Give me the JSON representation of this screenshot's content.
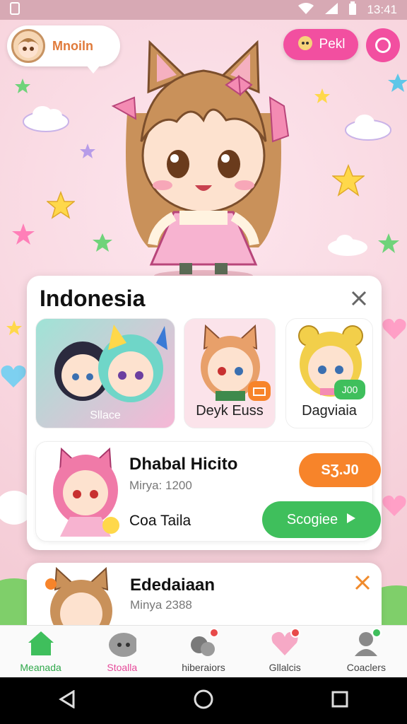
{
  "status_bar": {
    "time": "13:41"
  },
  "header": {
    "profile_name": "Mnoiln",
    "pill_label": "Pekl"
  },
  "card": {
    "title": "Indonesia",
    "tiles": [
      {
        "label": "Sllace"
      },
      {
        "label": "Deyk Euss"
      },
      {
        "label": "Dagviaia",
        "badge": "J00"
      }
    ],
    "item": {
      "name": "Dhabal Hicito",
      "sub": "Mirya: 1200",
      "label": "Coa Taila",
      "price": "SƷ.J0",
      "action": "Scogiee"
    }
  },
  "card2": {
    "title": "Ededaiaan",
    "sub": "Minya 2388"
  },
  "bottom_nav": [
    {
      "label": "Meanada"
    },
    {
      "label": "Stoalla"
    },
    {
      "label": "hiberaiors"
    },
    {
      "label": "Gllalcis"
    },
    {
      "label": "Coaclers"
    }
  ],
  "colors": {
    "accent_pink": "#f24fa0",
    "accent_green": "#3fbf5c",
    "accent_orange": "#f7842a"
  }
}
